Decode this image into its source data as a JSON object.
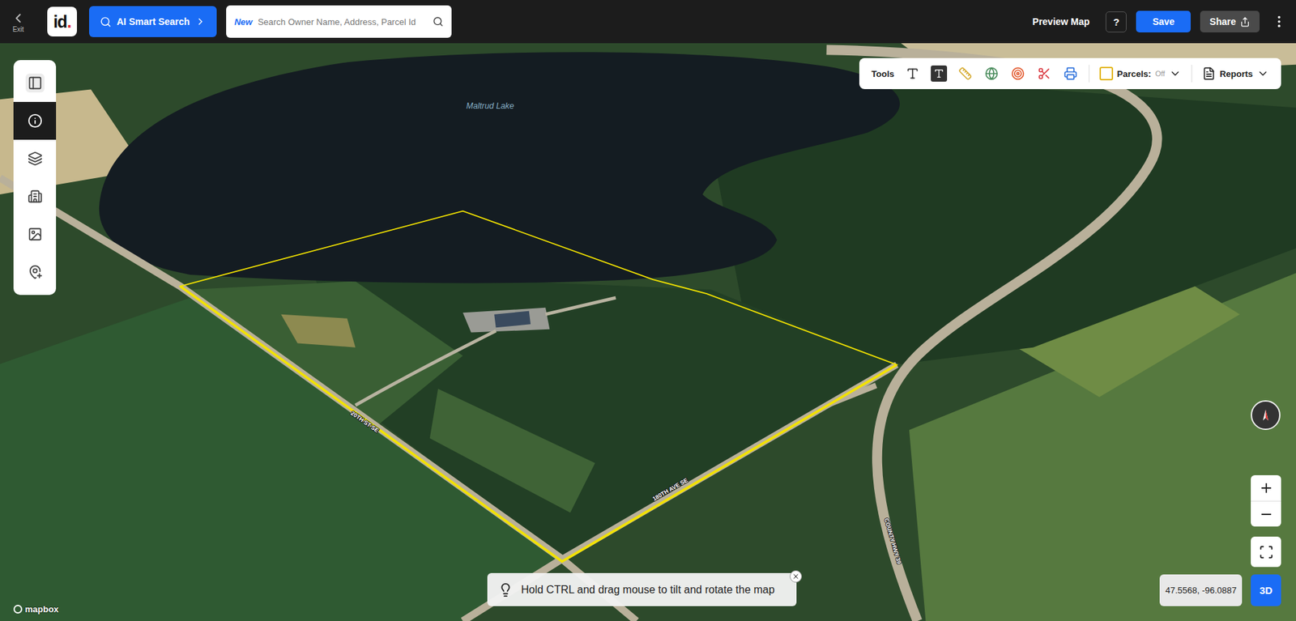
{
  "topbar": {
    "exit": {
      "label": "Exit"
    },
    "logo": {
      "text": "id",
      "dot": "."
    },
    "ai_search": {
      "label": "AI Smart Search"
    },
    "search": {
      "badge": "New",
      "placeholder": "Search Owner Name, Address, Parcel Id"
    },
    "actions": {
      "preview": "Preview Map",
      "help": "?",
      "save": "Save",
      "share": "Share"
    }
  },
  "sidebar": {
    "items": [
      {
        "kind": "panel",
        "selected": false
      },
      {
        "kind": "info",
        "selected": true
      },
      {
        "kind": "layers",
        "selected": false
      },
      {
        "kind": "buildings",
        "selected": false
      },
      {
        "kind": "imagery",
        "selected": false
      },
      {
        "kind": "add-place",
        "selected": false
      }
    ]
  },
  "tools": {
    "label": "Tools",
    "items": [
      {
        "kind": "text",
        "color": "#333333"
      },
      {
        "kind": "text-box",
        "color": "#333333"
      },
      {
        "kind": "ruler",
        "color": "#d4a82a"
      },
      {
        "kind": "globe",
        "color": "#4a8c5c"
      },
      {
        "kind": "radius",
        "color": "#e2572b"
      },
      {
        "kind": "scissors",
        "color": "#d9363e"
      },
      {
        "kind": "print",
        "color": "#2a6fdb"
      }
    ],
    "parcels": {
      "label": "Parcels:",
      "value": "Off",
      "on": false
    },
    "reports": {
      "label": "Reports"
    }
  },
  "map": {
    "labels": [
      {
        "text": "Maltrud Lake"
      },
      {
        "text": "20TH ST SE"
      },
      {
        "text": "180TH AVE SE"
      },
      {
        "text": "COUNTY HWY 39"
      }
    ]
  },
  "controls": {
    "coordinates": "47.5568, -96.0887",
    "view_mode": "3D"
  },
  "tip": {
    "text": "Hold CTRL and drag mouse to tilt and rotate the map"
  },
  "attribution": {
    "label": "mapbox"
  }
}
